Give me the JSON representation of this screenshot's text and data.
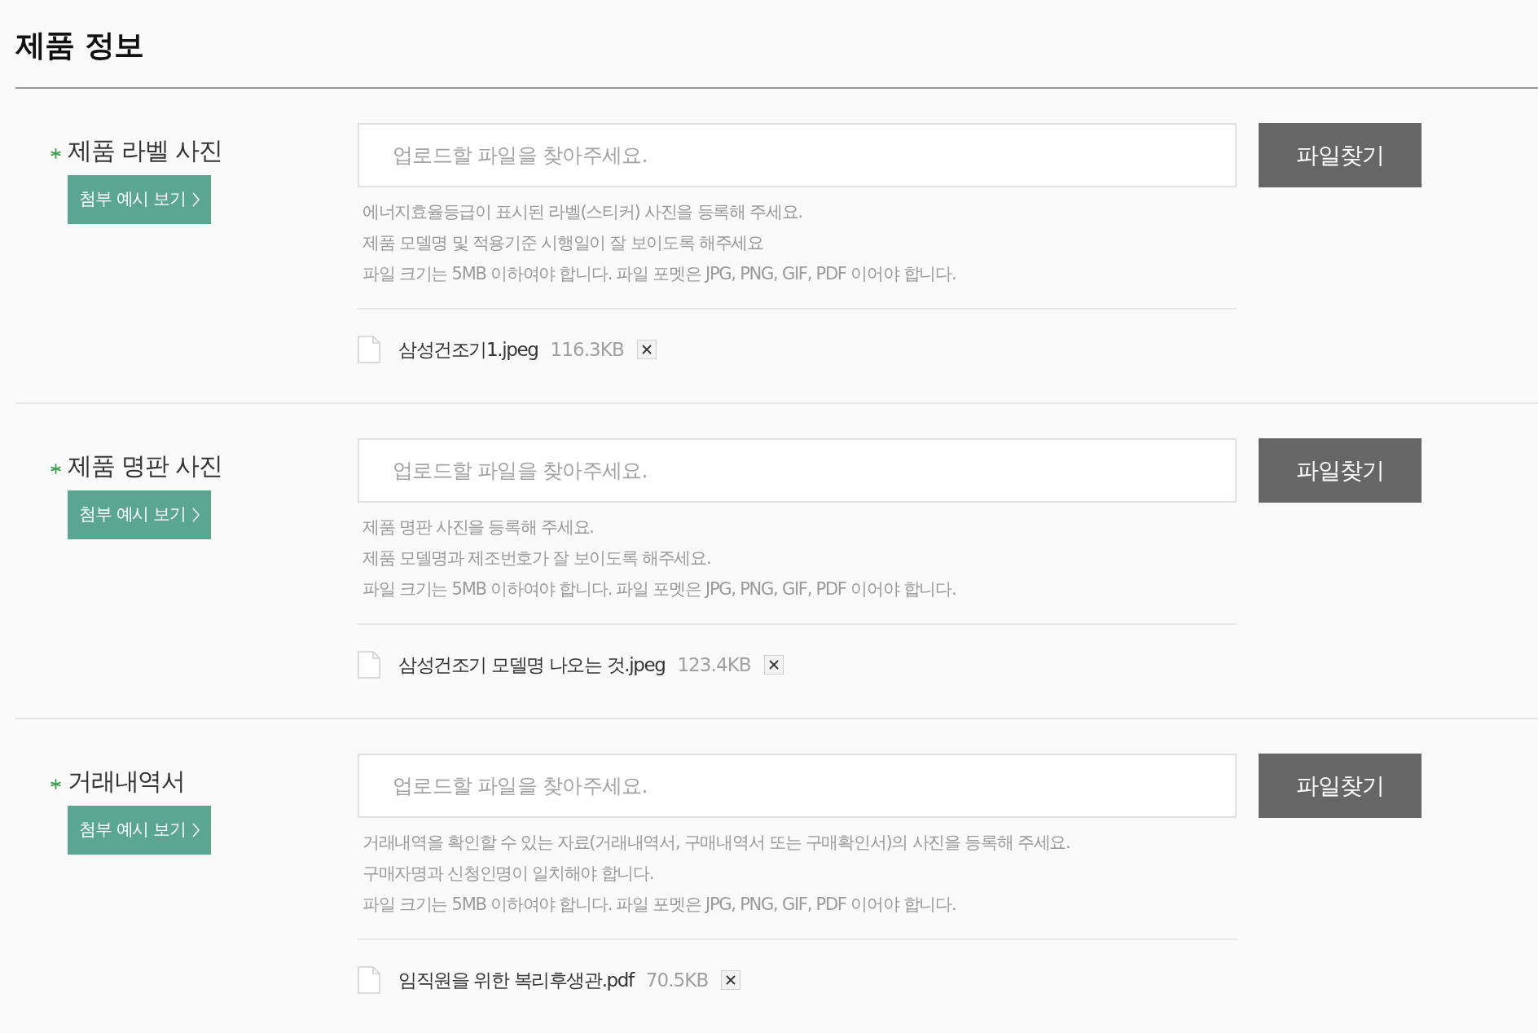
{
  "title": "제품 정보",
  "fields": [
    {
      "label": "제품 라벨 사진",
      "required": true,
      "example_button": "첨부 예시 보기",
      "file_input": {
        "placeholder": "업로드할 파일을 찾아주세요."
      },
      "browse_button": "파일찾기",
      "hints": [
        "에너지효율등급이 표시된 라벨(스티커) 사진을 등록해 주세요.",
        "제품 모델명 및 적용기준 시행일이 잘 보이도록 해주세요",
        "파일 크기는 5MB 이하여야 합니다. 파일 포멧은 JPG, PNG, GIF, PDF 이어야 합니다."
      ],
      "files": [
        {
          "name": "삼성건조기1.jpeg",
          "size": "116.3KB"
        }
      ]
    },
    {
      "label": "제품 명판 사진",
      "required": true,
      "example_button": "첨부 예시 보기",
      "file_input": {
        "placeholder": "업로드할 파일을 찾아주세요."
      },
      "browse_button": "파일찾기",
      "hints": [
        "제품 명판 사진을 등록해 주세요.",
        "제품 모델명과 제조번호가 잘 보이도록 해주세요.",
        "파일 크기는 5MB 이하여야 합니다. 파일 포멧은 JPG, PNG, GIF, PDF 이어야 합니다."
      ],
      "files": [
        {
          "name": "삼성건조기 모델명 나오는 것.jpeg",
          "size": "123.4KB"
        }
      ]
    },
    {
      "label": "거래내역서",
      "required": true,
      "example_button": "첨부 예시 보기",
      "file_input": {
        "placeholder": "업로드할 파일을 찾아주세요."
      },
      "browse_button": "파일찾기",
      "hints": [
        "거래내역을 확인할 수 있는 자료(거래내역서, 구매내역서 또는 구매확인서)의 사진을 등록해 주세요.",
        "구매자명과 신청인명이 일치해야 합니다.",
        "파일 크기는 5MB 이하여야 합니다. 파일 포멧은 JPG, PNG, GIF, PDF 이어야 합니다."
      ],
      "files": [
        {
          "name": "임직원을 위한 복리후생관.pdf",
          "size": "70.5KB"
        }
      ]
    }
  ]
}
